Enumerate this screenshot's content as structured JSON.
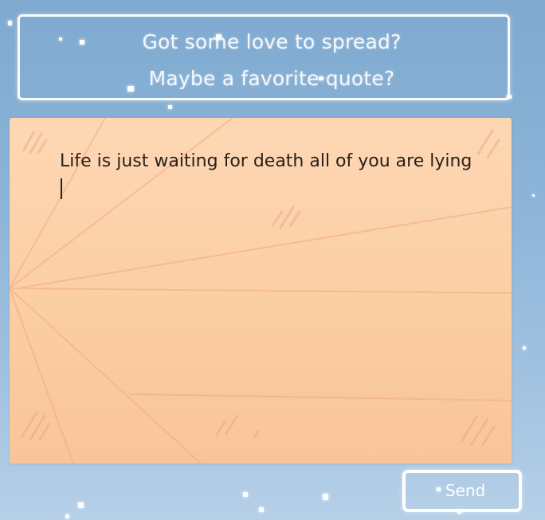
{
  "prompt": {
    "line1": "Got some love to spread?",
    "line2": "Maybe a favorite quote?"
  },
  "note": {
    "text": "Life is just waiting for death all of you are lying"
  },
  "send_button": {
    "label": "Send"
  },
  "colors": {
    "sky_top": "#7fa9cf",
    "sky_bottom": "#b6d0e8",
    "paper": "#fcd0a6",
    "paper_fold_lines": "#f3a982",
    "text_dark": "#2a211b",
    "ui_white": "#ffffff"
  }
}
